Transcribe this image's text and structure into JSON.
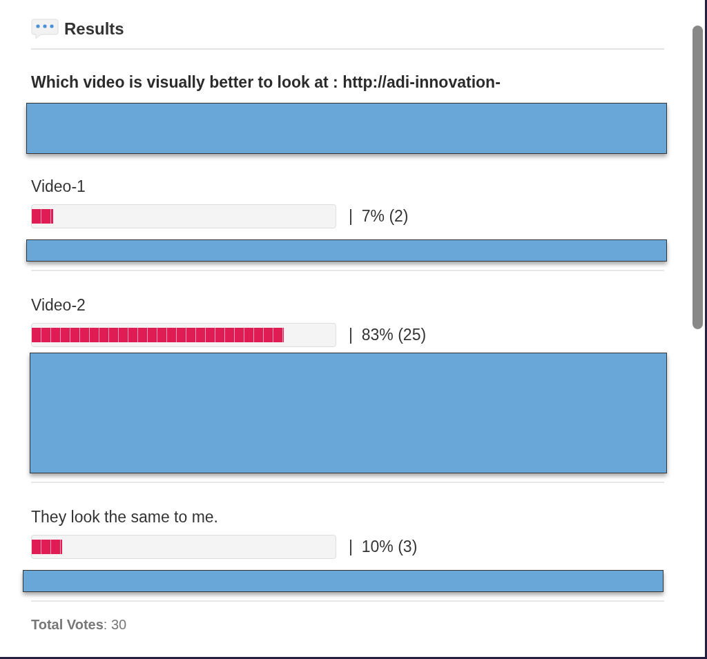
{
  "header": {
    "title": "Results"
  },
  "question": "Which video is visually better to look at : http://adi-innovation-",
  "options": [
    {
      "label": "Video-1",
      "level": 0.07,
      "reading": "|  7% (2)"
    },
    {
      "label": "Video-2",
      "level": 0.83,
      "reading": "|  83% (25)"
    },
    {
      "label": "They look the same to me.",
      "level": 0.1,
      "reading": "|  10% (3)"
    }
  ],
  "footer": "**Total Votes**: 30"
}
